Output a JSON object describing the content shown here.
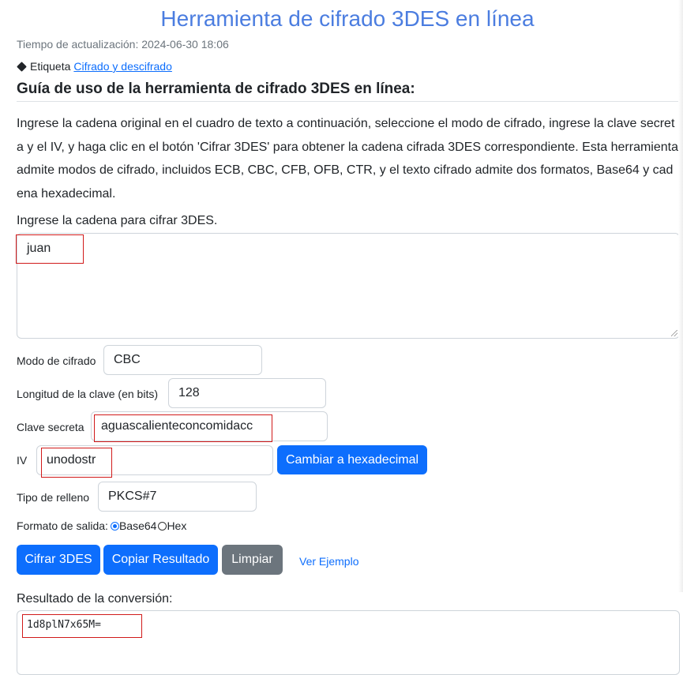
{
  "page": {
    "title": "Herramienta de cifrado 3DES en línea",
    "update_time": "Tiempo de actualización: 2024-06-30 18:06",
    "tag_label": "Etiqueta",
    "tag_link": "Cifrado y descifrado",
    "guide_heading": "Guía de uso de la herramienta de cifrado 3DES en línea:",
    "description": "Ingrese la cadena original en el cuadro de texto a continuación, seleccione el modo de cifrado, ingrese la clave secreta y el IV, y haga clic en el botón 'Cifrar 3DES' para obtener la cadena cifrada 3DES correspondiente. Esta herramienta admite modos de cifrado, incluidos ECB, CBC, CFB, OFB, CTR, y el texto cifrado admite dos formatos, Base64 y cadena hexadecimal."
  },
  "input_section": {
    "label": "Ingrese la cadena para cifrar 3DES.",
    "value": "juan"
  },
  "form": {
    "mode_label": "Modo de cifrado",
    "mode_value": "CBC",
    "key_length_label": "Longitud de la clave (en bits)",
    "key_length_value": "128",
    "secret_key_label": "Clave secreta",
    "secret_key_value": "aguascalienteconcomidacc",
    "iv_label": "IV",
    "iv_value": "unodostr",
    "hex_button": "Cambiar a hexadecimal",
    "padding_label": "Tipo de relleno",
    "padding_value": "PKCS#7",
    "format_label": "Formato de salida:",
    "format_base64": "Base64",
    "format_hex": "Hex",
    "format_selected": "Base64"
  },
  "actions": {
    "encrypt": "Cifrar 3DES",
    "copy": "Copiar Resultado",
    "clear": "Limpiar",
    "example": "Ver Ejemplo"
  },
  "result": {
    "label": "Resultado de la conversión:",
    "value": "1d8plN7x65M="
  },
  "colors": {
    "title": "#4b7de0",
    "primary": "#0d6efd",
    "secondary": "#6c757d",
    "highlight": "#d11a1a"
  }
}
